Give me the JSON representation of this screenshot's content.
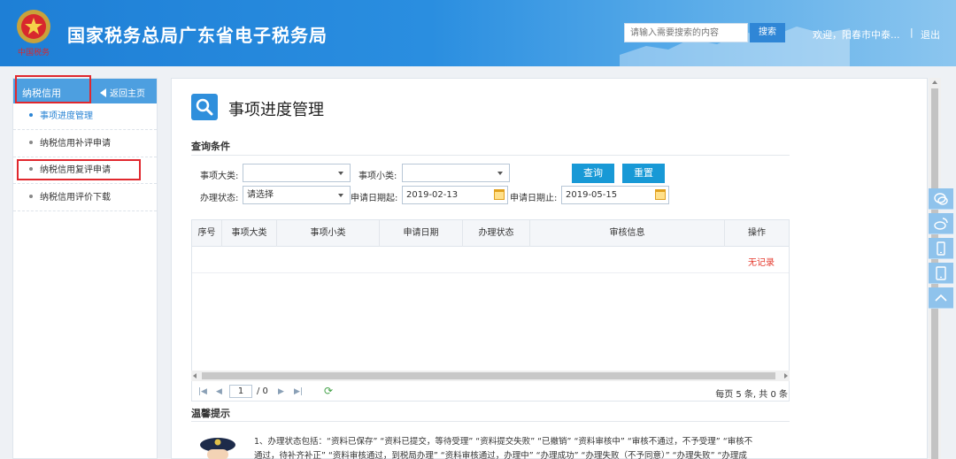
{
  "header": {
    "site_title": "国家税务总局广东省电子税务局",
    "emblem_caption": "中国税务",
    "search_placeholder": "请输入需要搜索的内容",
    "search_button": "搜索",
    "welcome": "欢迎，阳春市中泰...",
    "separator": "|",
    "logout": "退出"
  },
  "sidebar": {
    "title": "纳税信用",
    "back_home": "返回主页",
    "items": [
      {
        "label": "事项进度管理",
        "active": true
      },
      {
        "label": "纳税信用补评申请",
        "active": false
      },
      {
        "label": "纳税信用复评申请",
        "active": false
      },
      {
        "label": "纳税信用评价下载",
        "active": false
      }
    ]
  },
  "main": {
    "page_title": "事项进度管理",
    "query_section": "查询条件",
    "form": {
      "category_label": "事项大类:",
      "category_value": "",
      "subcategory_label": "事项小类:",
      "subcategory_value": "",
      "status_label": "办理状态:",
      "status_value": "请选择",
      "date_from_label": "申请日期起:",
      "date_from_value": "2019-02-13",
      "date_to_label": "申请日期止:",
      "date_to_value": "2019-05-15",
      "query_button": "查询",
      "reset_button": "重置"
    },
    "table": {
      "columns": [
        "序号",
        "事项大类",
        "事项小类",
        "申请日期",
        "办理状态",
        "审核信息",
        "操作"
      ],
      "no_record": "无记录"
    },
    "pager": {
      "page_value": "1",
      "total_pages": "/ 0",
      "summary": "每页 5 条, 共 0 条"
    },
    "tips": {
      "title": "温馨提示",
      "line1": "1、办理状态包括：“资料已保存” “资料已提交，等待受理” “资料提交失败” “已撤销” “资料审核中” “审核不通过，不予受理” “审核不",
      "line2": "通过，待补齐补正” “资料审核通过，到税局办理” “资料审核通过，办理中” “办理成功” “办理失败（不予同意）” “办理失败” “办理成"
    }
  },
  "colors": {
    "header_blue": "#1e7fd6",
    "accent": "#2a84d4",
    "button": "#1899d6",
    "no_record": "#e53a2e",
    "highlight_box": "#e0282e"
  },
  "icons": [
    "tax-emblem-icon",
    "search-icon",
    "back-arrow-icon",
    "calendar-icon",
    "refresh-icon",
    "chat-icon",
    "weibo-icon",
    "mobile-icon",
    "tablet-icon",
    "scroll-top-icon"
  ]
}
